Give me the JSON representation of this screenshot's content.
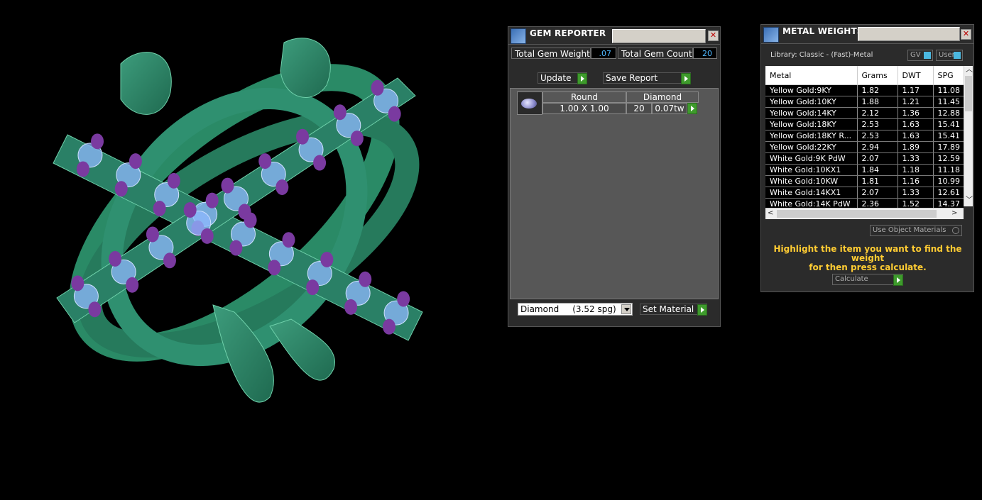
{
  "gem_reporter": {
    "title": "GEM REPORTER",
    "total_weight_label": "Total Gem Weight",
    "total_weight_value": ".07",
    "total_count_label": "Total Gem Count",
    "total_count_value": "20",
    "update_label": "Update",
    "save_report_label": "Save Report",
    "gem": {
      "shape": "Round",
      "material": "Diamond",
      "size": "1.00 X 1.00",
      "count": "20",
      "weight": "0.07tw"
    },
    "material_select": "Diamond     (3.52 spg)",
    "set_material_label": "Set Material",
    "close_symbol": "✕"
  },
  "metal_weights": {
    "title": "METAL WEIGHTS",
    "library_label": "Library: Classic - (Fast)-Metal",
    "gv_label": "GV",
    "user_label": "User",
    "columns": [
      "Metal",
      "Grams",
      "DWT",
      "SPG"
    ],
    "rows": [
      [
        "Yellow Gold:9KY",
        "1.82",
        "1.17",
        "11.08"
      ],
      [
        "Yellow Gold:10KY",
        "1.88",
        "1.21",
        "11.45"
      ],
      [
        "Yellow Gold:14KY",
        "2.12",
        "1.36",
        "12.88"
      ],
      [
        "Yellow Gold:18KY",
        "2.53",
        "1.63",
        "15.41"
      ],
      [
        "Yellow Gold:18KY R...",
        "2.53",
        "1.63",
        "15.41"
      ],
      [
        "Yellow Gold:22KY",
        "2.94",
        "1.89",
        "17.89"
      ],
      [
        "White Gold:9K PdW",
        "2.07",
        "1.33",
        "12.59"
      ],
      [
        "White Gold:10KX1",
        "1.84",
        "1.18",
        "11.18"
      ],
      [
        "White Gold:10KW",
        "1.81",
        "1.16",
        "10.99"
      ],
      [
        "White Gold:14KX1",
        "2.07",
        "1.33",
        "12.61"
      ],
      [
        "White Gold:14K PdW",
        "2.36",
        "1.52",
        "14.37"
      ]
    ],
    "use_object_label": "Use Object Materials",
    "hint_line1": "Highlight the item you want to find the weight",
    "hint_line2": "for then press calculate.",
    "calculate_label": "Calculate",
    "close_symbol": "✕"
  },
  "colors": {
    "metal": "#2f8a6a",
    "prong": "#7a3aa0",
    "stone": "#8fb8ff",
    "accent_value": "#4fb8ff",
    "hint": "#ffcc33",
    "go_button": "#3e9b2c"
  }
}
